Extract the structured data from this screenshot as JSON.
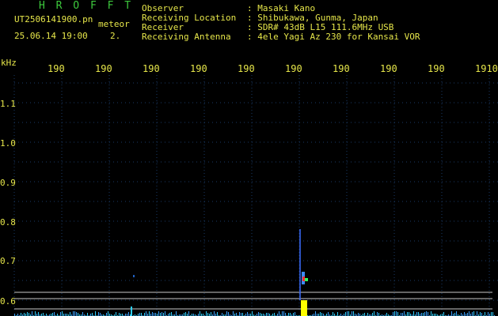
{
  "header": {
    "program": "H R O F F T",
    "filename": "UT2506141900.pn",
    "mode": "meteor",
    "datetime": "25.06.14 19:00",
    "index": "2.",
    "labels": {
      "observer": "Observer",
      "location": "Receiving Location",
      "receiver": "Receiver",
      "antenna": "Receiving Antenna"
    },
    "values": {
      "observer": ": Masaki Kano",
      "location": ": Shibukawa, Gunma, Japan",
      "receiver": ": SDR# 43dB L15 111.6MHz USB",
      "antenna": ": 4ele Yagi Az 230 for Kansai VOR"
    }
  },
  "axis": {
    "unit": "kHz",
    "x_ticks": [
      "190",
      "190",
      "190",
      "190",
      "190",
      "190",
      "190",
      "190",
      "190",
      "1910"
    ],
    "y_ticks": [
      "1.1",
      "1.0",
      "0.9",
      "0.8",
      "0.7",
      "0.6"
    ]
  },
  "colors": {
    "background": "#000000",
    "grid_dots": "#1a3a66",
    "header_text": "#e6e64a",
    "title_green": "#3dc93d",
    "meteor_trace": "#3a6cff",
    "hot_spot": "#ffff00",
    "reference_line": "#c8c8c8"
  }
}
